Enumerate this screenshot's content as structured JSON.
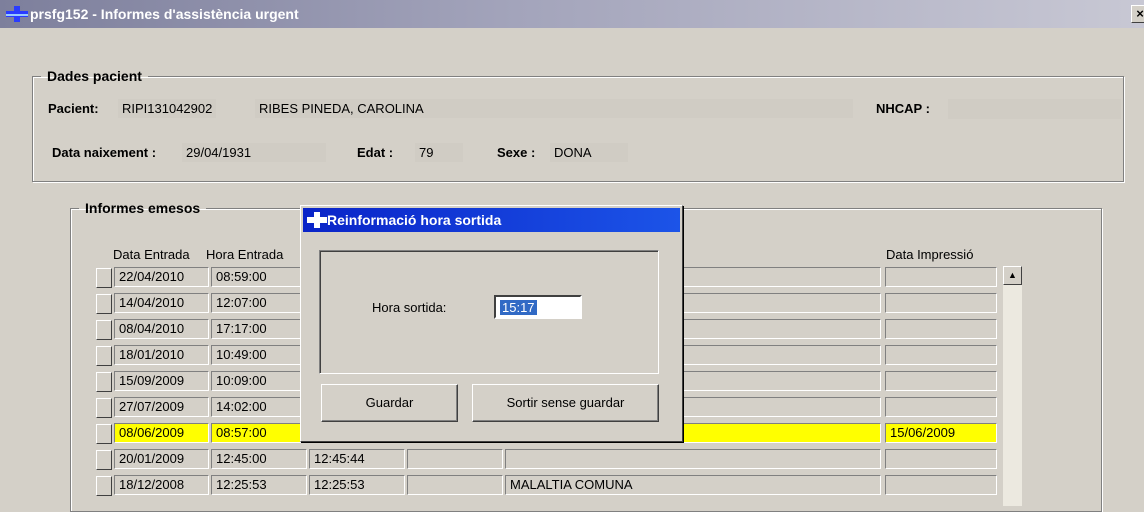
{
  "window": {
    "title": "prsfg152 - Informes d'assistència urgent",
    "close_glyph": "×"
  },
  "patient": {
    "legend": "Dades pacient",
    "pacient_label": "Pacient:",
    "pacient_id": "RIPI131042902",
    "pacient_name": "RIBES PINEDA, CAROLINA",
    "nhcap_label": "NHCAP :",
    "birth_label": "Data naixement :",
    "birth_value": "29/04/1931",
    "age_label": "Edat :",
    "age_value": "79",
    "sex_label": "Sexe :",
    "sex_value": "DONA"
  },
  "reports": {
    "legend": "Informes emesos",
    "columns": [
      "Data Entrada",
      "Hora Entrada",
      "Data Impressió"
    ],
    "rows": [
      {
        "date": "22/04/2010",
        "time": "08:59:00",
        "c3": "",
        "c4": "",
        "diag": "",
        "print": ""
      },
      {
        "date": "14/04/2010",
        "time": "12:07:00",
        "c3": "",
        "c4": "",
        "diag": "",
        "print": ""
      },
      {
        "date": "08/04/2010",
        "time": "17:17:00",
        "c3": "",
        "c4": "",
        "diag": "",
        "print": ""
      },
      {
        "date": "18/01/2010",
        "time": "10:49:00",
        "c3": "",
        "c4": "",
        "diag": "",
        "print": ""
      },
      {
        "date": "15/09/2009",
        "time": "10:09:00",
        "c3": "",
        "c4": "",
        "diag": "",
        "print": ""
      },
      {
        "date": "27/07/2009",
        "time": "14:02:00",
        "c3": "",
        "c4": "",
        "diag": "",
        "print": ""
      },
      {
        "date": "08/06/2009",
        "time": "08:57:00",
        "c3": "",
        "c4": "",
        "diag": "",
        "print": "15/06/2009"
      },
      {
        "date": "20/01/2009",
        "time": "12:45:00",
        "c3": "12:45:44",
        "c4": "",
        "diag": "",
        "print": ""
      },
      {
        "date": "18/12/2008",
        "time": "12:25:53",
        "c3": "12:25:53",
        "c4": "",
        "diag": "MALALTIA COMUNA",
        "print": ""
      }
    ],
    "highlight_color": "#ffff00"
  },
  "dialog": {
    "title": "Reinformació hora sortida",
    "label": "Hora sortida:",
    "value": "15:17",
    "save_label": "Guardar",
    "exit_label": "Sortir sense guardar"
  },
  "colors": {
    "face": "#d4d0c8",
    "dialog_title": "#0a24c8"
  }
}
